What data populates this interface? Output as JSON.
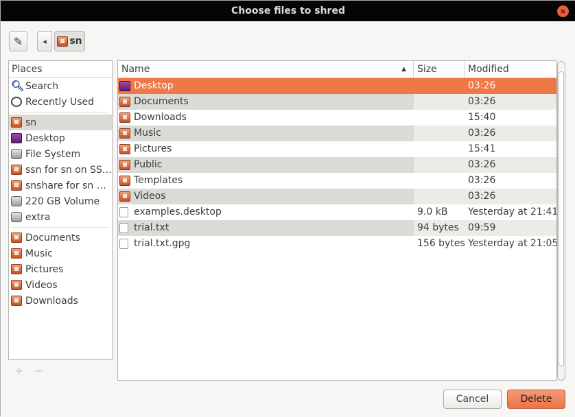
{
  "window": {
    "title": "Choose files to shred",
    "close": "×"
  },
  "toolbar": {
    "edit_icon": "pencil-icon",
    "back": "◂",
    "crumb": "sn"
  },
  "places": {
    "header": "Places",
    "group1": [
      {
        "label": "Search",
        "icon": "search"
      },
      {
        "label": "Recently Used",
        "icon": "clock"
      }
    ],
    "group2": [
      {
        "label": "sn",
        "icon": "home-folder"
      },
      {
        "label": "Desktop",
        "icon": "desktop"
      },
      {
        "label": "File System",
        "icon": "drive"
      },
      {
        "label": "ssn for sn on SS…",
        "icon": "network-folder"
      },
      {
        "label": "snshare for sn …",
        "icon": "network-folder"
      },
      {
        "label": "220 GB Volume",
        "icon": "drive"
      },
      {
        "label": "extra",
        "icon": "drive"
      }
    ],
    "group3": [
      {
        "label": "Documents"
      },
      {
        "label": "Music"
      },
      {
        "label": "Pictures"
      },
      {
        "label": "Videos"
      },
      {
        "label": "Downloads"
      }
    ],
    "add": "+",
    "remove": "−"
  },
  "files": {
    "columns": {
      "name": "Name",
      "size": "Size",
      "modified": "Modified"
    },
    "rows": [
      {
        "name": "Desktop",
        "size": "",
        "modified": "03:26",
        "type": "desktop"
      },
      {
        "name": "Documents",
        "size": "",
        "modified": "03:26",
        "type": "folder"
      },
      {
        "name": "Downloads",
        "size": "",
        "modified": "15:40",
        "type": "folder"
      },
      {
        "name": "Music",
        "size": "",
        "modified": "03:26",
        "type": "folder"
      },
      {
        "name": "Pictures",
        "size": "",
        "modified": "15:41",
        "type": "folder"
      },
      {
        "name": "Public",
        "size": "",
        "modified": "03:26",
        "type": "folder"
      },
      {
        "name": "Templates",
        "size": "",
        "modified": "03:26",
        "type": "folder"
      },
      {
        "name": "Videos",
        "size": "",
        "modified": "03:26",
        "type": "folder"
      },
      {
        "name": "examples.desktop",
        "size": "9.0 kB",
        "modified": "Yesterday at 21:41",
        "type": "file"
      },
      {
        "name": "trial.txt",
        "size": "94 bytes",
        "modified": "09:59",
        "type": "file"
      },
      {
        "name": "trial.txt.gpg",
        "size": "156 bytes",
        "modified": "Yesterday at 21:05",
        "type": "file"
      }
    ]
  },
  "buttons": {
    "cancel": "Cancel",
    "delete": "Delete"
  },
  "colors": {
    "accent": "#f07746",
    "titlebar": "#050505"
  }
}
